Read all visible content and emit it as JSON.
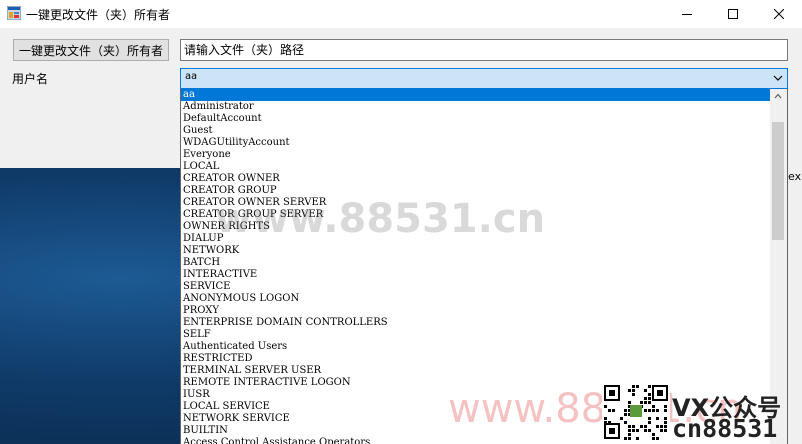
{
  "window": {
    "title": "一键更改文件（夹）所有者"
  },
  "form": {
    "change_owner_button": "一键更改文件（夹）所有者",
    "path_placeholder": "请输入文件（夹）路径",
    "user_label": "用户名",
    "user_selected": "aa"
  },
  "dropdown": {
    "options": [
      "aa",
      "Administrator",
      "DefaultAccount",
      "Guest",
      "WDAGUtilityAccount",
      "Everyone",
      "LOCAL",
      "CREATOR OWNER",
      "CREATOR GROUP",
      "CREATOR OWNER SERVER",
      "CREATOR GROUP SERVER",
      "OWNER RIGHTS",
      "DIALUP",
      "NETWORK",
      "BATCH",
      "INTERACTIVE",
      "SERVICE",
      "ANONYMOUS LOGON",
      "PROXY",
      "ENTERPRISE DOMAIN CONTROLLERS",
      "SELF",
      "Authenticated Users",
      "RESTRICTED",
      "TERMINAL SERVER USER",
      "REMOTE INTERACTIVE LOGON",
      "IUSR",
      "LOCAL SERVICE",
      "NETWORK SERVICE",
      "BUILTIN",
      "Access Control Assistance Operators"
    ]
  },
  "background": {
    "partial_text": "ex"
  },
  "watermark": {
    "center": "www.88531.cn",
    "bottom": "www.88531.cn",
    "vx": "VX公众号",
    "cn": "cn88531"
  },
  "icons": {
    "app": "app-icon",
    "minimize": "minimize-icon",
    "maximize": "maximize-icon",
    "close": "close-icon",
    "dropdown_arrow": "chevron-down-icon",
    "scroll_up": "scroll-up-icon",
    "qr": "qr-code-icon"
  },
  "colors": {
    "selection": "#0078d7",
    "combo_bg": "#cce4f7",
    "window_bg": "#f0f0f0"
  }
}
